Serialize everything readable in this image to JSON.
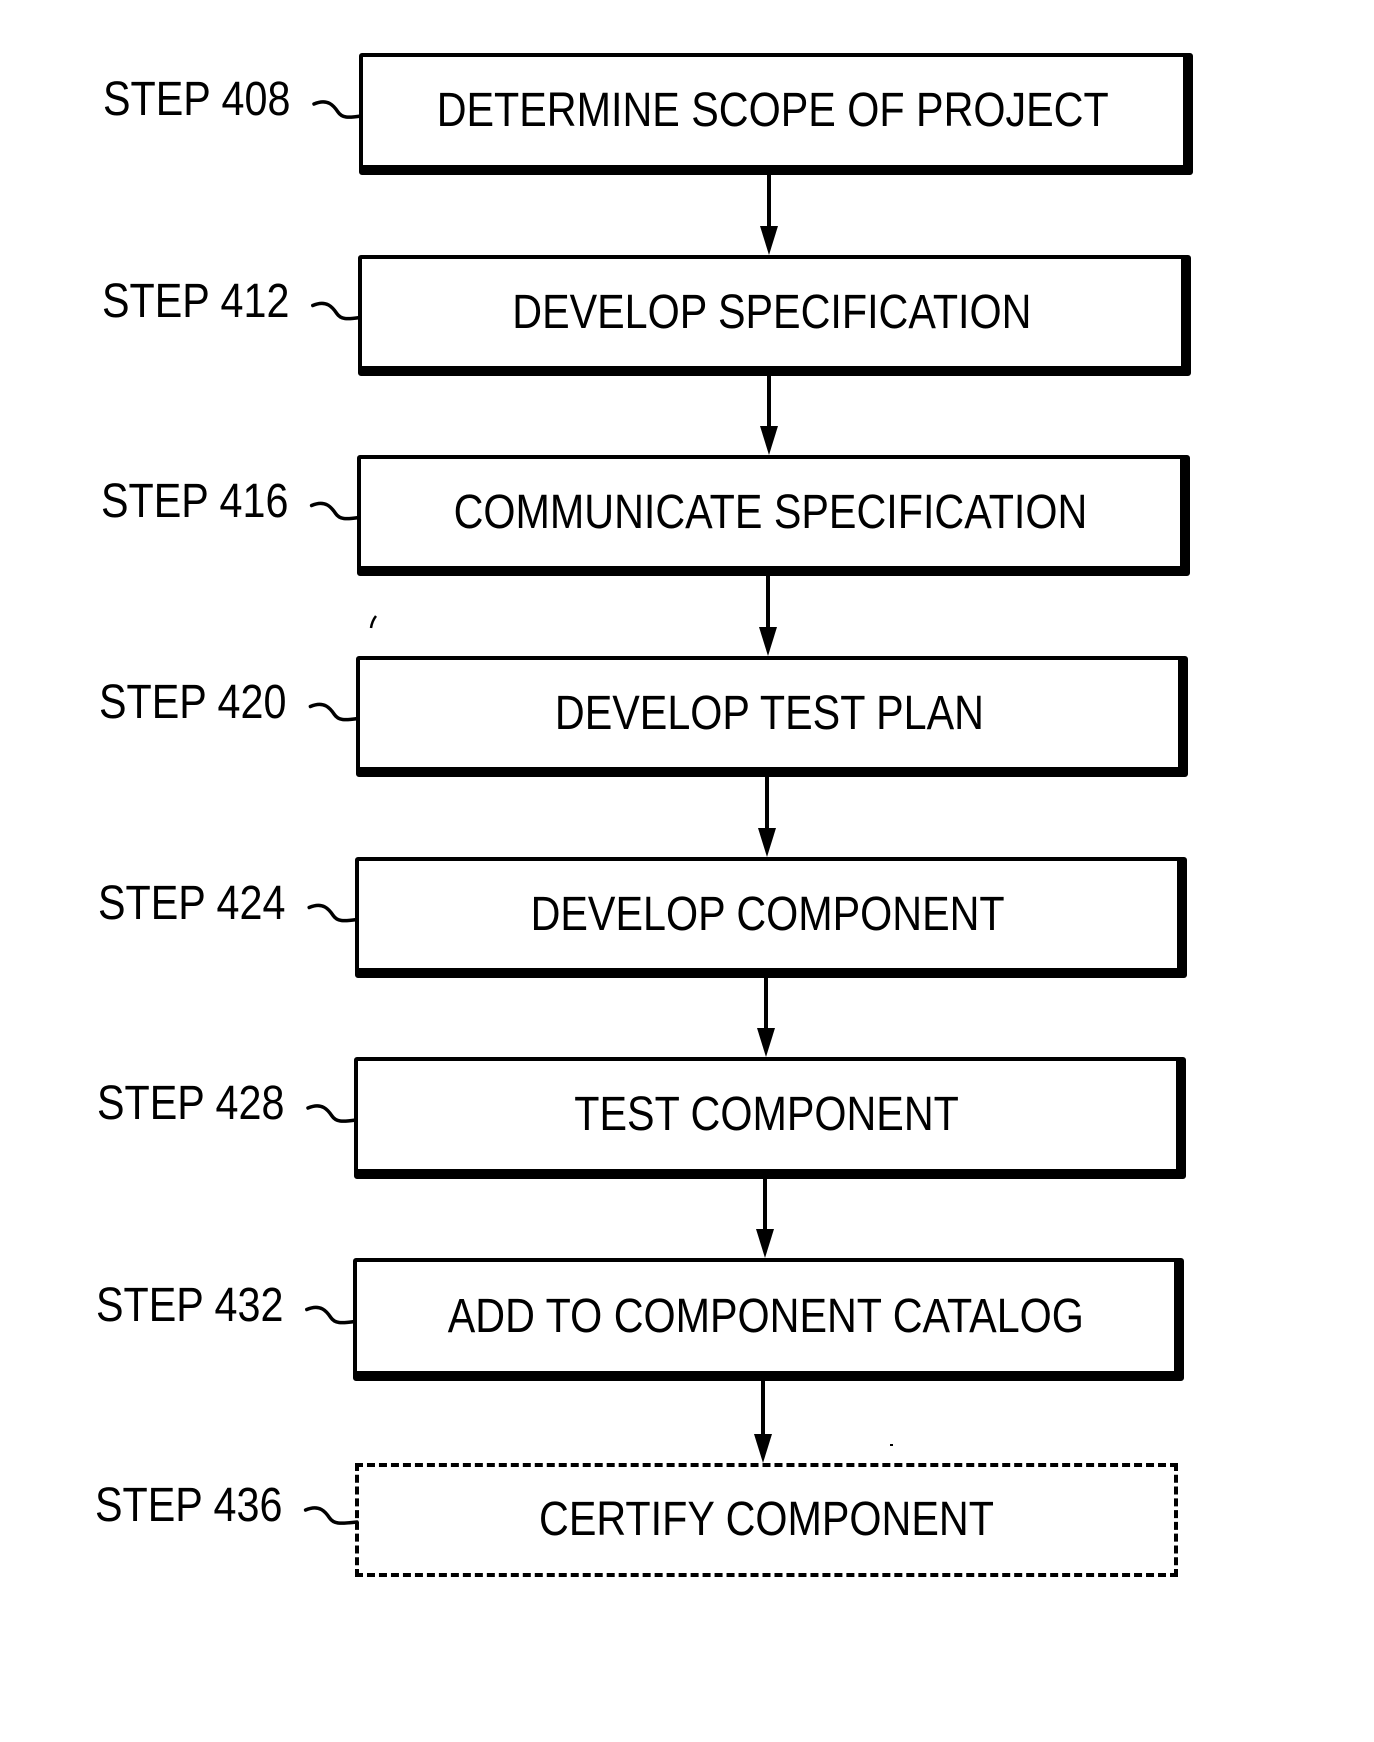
{
  "diagram": {
    "type": "flowchart",
    "direction": "top-to-bottom",
    "steps": [
      {
        "id": "STEP 408",
        "label": "STEP 408",
        "text": "DETERMINE SCOPE OF PROJECT",
        "style": "solid"
      },
      {
        "id": "STEP 412",
        "label": "STEP 412",
        "text": "DEVELOP SPECIFICATION",
        "style": "solid"
      },
      {
        "id": "STEP 416",
        "label": "STEP 416",
        "text": "COMMUNICATE SPECIFICATION",
        "style": "solid"
      },
      {
        "id": "STEP 420",
        "label": "STEP 420",
        "text": "DEVELOP TEST PLAN",
        "style": "solid"
      },
      {
        "id": "STEP 424",
        "label": "STEP 424",
        "text": "DEVELOP COMPONENT",
        "style": "solid"
      },
      {
        "id": "STEP 428",
        "label": "STEP 428",
        "text": "TEST COMPONENT",
        "style": "solid"
      },
      {
        "id": "STEP 432",
        "label": "STEP 432",
        "text": "ADD TO COMPONENT CATALOG",
        "style": "solid"
      },
      {
        "id": "STEP 436",
        "label": "STEP 436",
        "text": "CERTIFY COMPONENT",
        "style": "dashed"
      }
    ],
    "edges": [
      {
        "from": "STEP 408",
        "to": "STEP 412"
      },
      {
        "from": "STEP 412",
        "to": "STEP 416"
      },
      {
        "from": "STEP 416",
        "to": "STEP 420"
      },
      {
        "from": "STEP 420",
        "to": "STEP 424"
      },
      {
        "from": "STEP 424",
        "to": "STEP 428"
      },
      {
        "from": "STEP 428",
        "to": "STEP 432"
      },
      {
        "from": "STEP 432",
        "to": "STEP 436"
      }
    ],
    "colors": {
      "ink": "#000000",
      "background": "#ffffff"
    }
  }
}
